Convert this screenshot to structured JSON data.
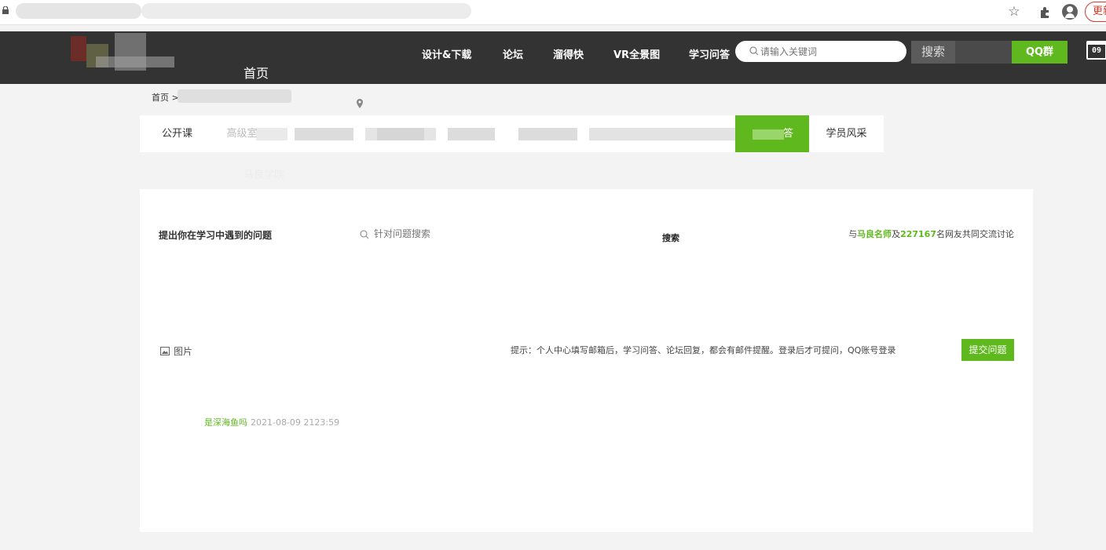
{
  "browser": {
    "update_label": "更新"
  },
  "header": {
    "home": "首页",
    "nav": [
      "设计&下载",
      "论坛",
      "溜得快",
      "VR全景图",
      "学习问答"
    ],
    "search_placeholder": "请输入关键词",
    "search_button": "搜索",
    "qq_button": "QQ群",
    "calendar_day": "09"
  },
  "breadcrumb": {
    "home": "首页 >"
  },
  "tabs": {
    "first": "公开课",
    "second_partial": "高级室",
    "active": "答",
    "last": "学员风采"
  },
  "ghost_text": "马良学院",
  "panel": {
    "ask_title": "提出你在学习中遇到的问题",
    "search_placeholder": "针对问题搜索",
    "search_button": "搜索",
    "community": {
      "prefix": "与",
      "teachers": "马良名师",
      "middle": "及",
      "count": "227167",
      "suffix": "名网友共同交流讨论"
    },
    "image_button": "图片",
    "hint": "提示：个人中心填写邮箱后，学习问答、论坛回复，都会有邮件提醒。登录后才可提问，QQ账号登录",
    "submit_button": "提交问题",
    "author": "是深海鱼吗",
    "time": "2021-08-09 2123:59"
  },
  "colors": {
    "accent_green": "#5fb91e",
    "header_bg": "#333333",
    "page_bg": "#f3f3f3"
  }
}
